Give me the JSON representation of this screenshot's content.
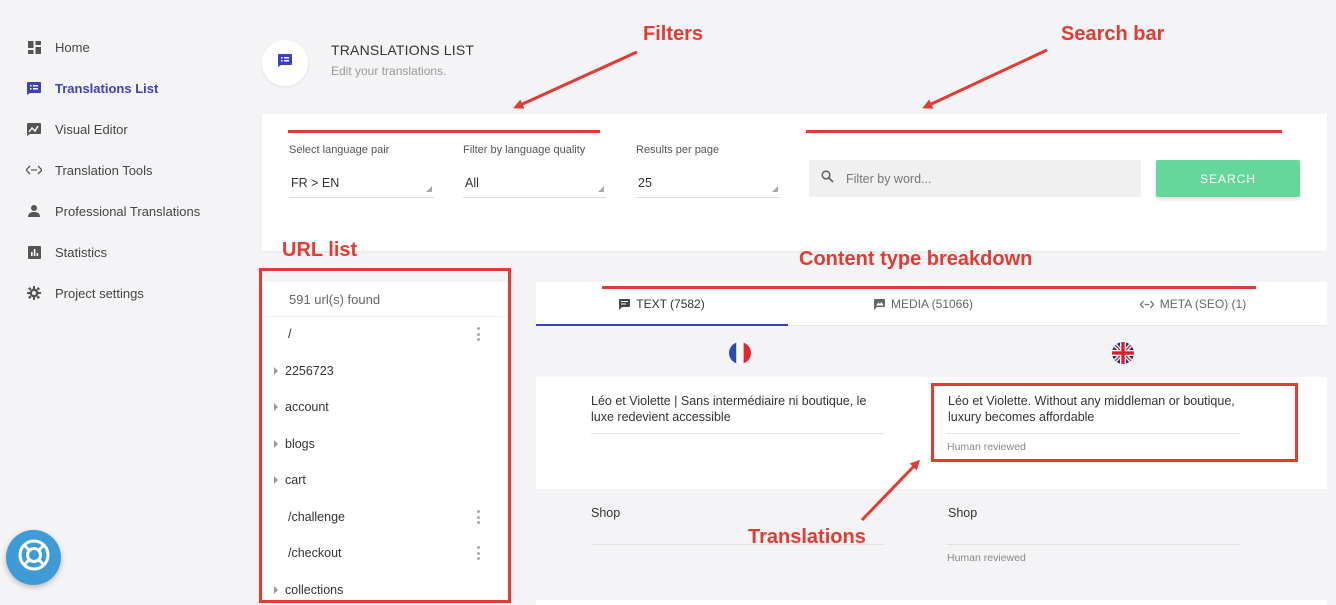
{
  "sidebar": {
    "items": [
      {
        "label": "Home",
        "icon": "dashboard-icon"
      },
      {
        "label": "Translations List",
        "icon": "list-icon"
      },
      {
        "label": "Visual Editor",
        "icon": "image-edit-icon"
      },
      {
        "label": "Translation Tools",
        "icon": "code-arrows-icon"
      },
      {
        "label": "Professional Translations",
        "icon": "person-icon"
      },
      {
        "label": "Statistics",
        "icon": "bar-chart-icon"
      },
      {
        "label": "Project settings",
        "icon": "gear-icon"
      }
    ],
    "active_index": 1
  },
  "header": {
    "title": "TRANSLATIONS LIST",
    "subtitle": "Edit your translations."
  },
  "filters": {
    "language_pair_label": "Select language pair",
    "language_pair_value": "FR > EN",
    "quality_label": "Filter by language quality",
    "quality_value": "All",
    "results_label": "Results per page",
    "results_value": "25",
    "search_placeholder": "Filter by word...",
    "search_button": "SEARCH"
  },
  "url_list": {
    "count": "591 url(s) found",
    "items": [
      {
        "label": "/",
        "expandable": false
      },
      {
        "label": "2256723",
        "expandable": true
      },
      {
        "label": "account",
        "expandable": true
      },
      {
        "label": "blogs",
        "expandable": true
      },
      {
        "label": "cart",
        "expandable": true
      },
      {
        "label": "/challenge",
        "expandable": false
      },
      {
        "label": "/checkout",
        "expandable": false
      },
      {
        "label": "collections",
        "expandable": true
      }
    ]
  },
  "tabs": [
    {
      "label": "TEXT (7582)",
      "icon": "comment-icon"
    },
    {
      "label": "MEDIA (51066)",
      "icon": "image-icon"
    },
    {
      "label": "META (SEO) (1)",
      "icon": "code-arrows-icon"
    }
  ],
  "translations": [
    {
      "source": "Léo et Violette | Sans intermédiaire ni boutique, le luxe redevient accessible",
      "target": "Léo et Violette. Without any middleman or boutique, luxury becomes affordable",
      "status": "Human reviewed"
    },
    {
      "source": "Shop",
      "target": "Shop",
      "status": "Human reviewed"
    }
  ],
  "annotations": {
    "filters": "Filters",
    "search_bar": "Search bar",
    "url_list": "URL list",
    "content_type": "Content type breakdown",
    "translations": "Translations"
  },
  "colors": {
    "accent": "#3d3ec6",
    "search_button": "#65d79a",
    "annotation": "#e23b32",
    "help_button": "#3e9bd6"
  }
}
